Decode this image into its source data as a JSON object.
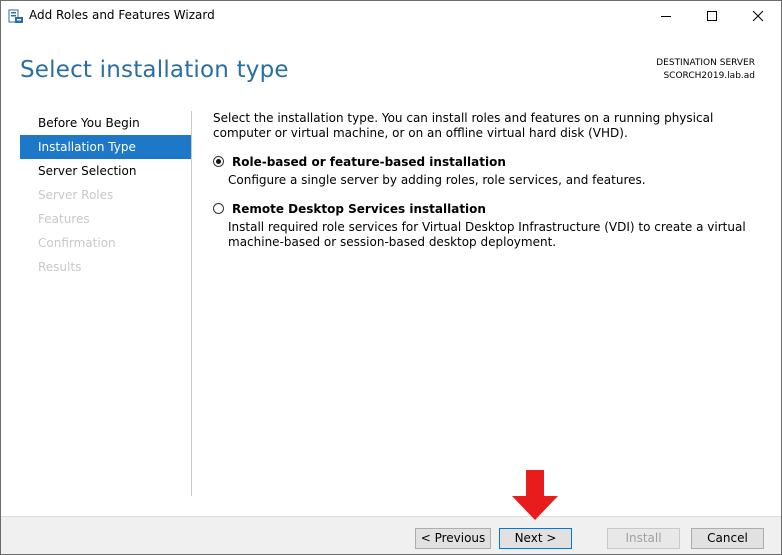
{
  "window": {
    "title": "Add Roles and Features Wizard"
  },
  "header": {
    "page_title": "Select installation type",
    "destination_label": "DESTINATION SERVER",
    "destination_server": "SCORCH2019.lab.ad"
  },
  "nav": {
    "items": [
      {
        "label": "Before You Begin",
        "state": "normal"
      },
      {
        "label": "Installation Type",
        "state": "active"
      },
      {
        "label": "Server Selection",
        "state": "normal"
      },
      {
        "label": "Server Roles",
        "state": "disabled"
      },
      {
        "label": "Features",
        "state": "disabled"
      },
      {
        "label": "Confirmation",
        "state": "disabled"
      },
      {
        "label": "Results",
        "state": "disabled"
      }
    ]
  },
  "content": {
    "intro": "Select the installation type. You can install roles and features on a running physical computer or virtual machine, or on an offline virtual hard disk (VHD).",
    "options": [
      {
        "title": "Role-based or feature-based installation",
        "description": "Configure a single server by adding roles, role services, and features.",
        "selected": true
      },
      {
        "title": "Remote Desktop Services installation",
        "description": "Install required role services for Virtual Desktop Infrastructure (VDI) to create a virtual machine-based or session-based desktop deployment.",
        "selected": false
      }
    ]
  },
  "footer": {
    "previous_label": "< Previous",
    "next_label": "Next >",
    "install_label": "Install",
    "cancel_label": "Cancel"
  },
  "colors": {
    "accent": "#1e78c8",
    "title": "#2a6ea4",
    "annotation_arrow": "#e81c1c"
  }
}
